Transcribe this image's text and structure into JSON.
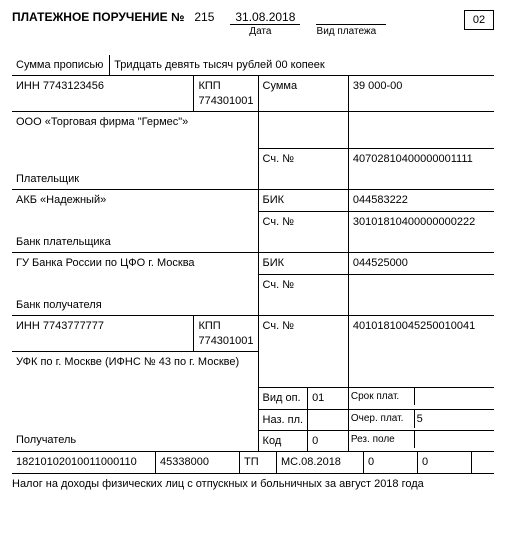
{
  "header": {
    "title": "ПЛАТЕЖНОЕ ПОРУЧЕНИЕ №",
    "number": "215",
    "date": "31.08.2018",
    "date_label": "Дата",
    "payment_type_label": "Вид платежа",
    "code_box": "02"
  },
  "labels": {
    "sum_words": "Сумма прописью",
    "inn": "ИНН",
    "kpp": "КПП",
    "sum": "Сумма",
    "account": "Сч. №",
    "payer": "Плательщик",
    "bik": "БИК",
    "payer_bank": "Банк плательщика",
    "payee_bank": "Банк получателя",
    "op_type": "Вид оп.",
    "pay_term": "Срок плат.",
    "naz_pl": "Наз. пл.",
    "ocher": "Очер. плат.",
    "code": "Код",
    "rez": "Рез. поле",
    "payee": "Получатель"
  },
  "sum_words": "Тридцать девять тысяч рублей 00 копеек",
  "payer": {
    "inn": "7743123456",
    "kpp": "774301001",
    "name": "ООО «Торговая фирма \"Гермес\"»",
    "sum": "39 000-00",
    "account": "40702810400000001111"
  },
  "payer_bank": {
    "name": "АКБ «Надежный»",
    "bik": "044583222",
    "account": "30101810400000000222"
  },
  "payee_bank": {
    "name": "ГУ Банка России по ЦФО г. Москва",
    "bik": "044525000",
    "account": ""
  },
  "payee": {
    "inn": "7743777777",
    "kpp": "774301001",
    "account": "40101810045250010041",
    "name": "УФК по г. Москве (ИФНС № 43 по г. Москве)"
  },
  "footer": {
    "op_type": "01",
    "pay_term": "",
    "naz_pl": "",
    "ocher": "5",
    "code": "0",
    "rez": ""
  },
  "bottom_row": {
    "kbk": "18210102010011000110",
    "oktmo": "45338000",
    "tp": "ТП",
    "period": "МС.08.2018",
    "f5": "0",
    "f6": "0",
    "f7": ""
  },
  "purpose": "Налог на доходы физических лиц с отпускных и больничных за август 2018 года"
}
